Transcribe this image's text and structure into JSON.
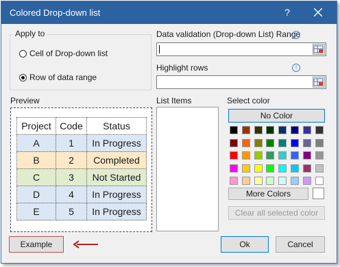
{
  "window": {
    "title": "Colored Drop-down list",
    "help_glyph": "?"
  },
  "apply_to": {
    "label": "Apply to",
    "options": [
      {
        "label": "Cell of Drop-down list",
        "checked": false
      },
      {
        "label": "Row of data range",
        "checked": true
      }
    ]
  },
  "data_validation": {
    "label": "Data validation (Drop-down List) Range",
    "value": ""
  },
  "highlight_rows": {
    "label": "Highlight rows",
    "value": ""
  },
  "preview": {
    "label": "Preview",
    "headers": [
      "Project",
      "Code",
      "Status"
    ],
    "rows": [
      {
        "project": "A",
        "code": "1",
        "status": "In Progress",
        "color": "#dbe7f4"
      },
      {
        "project": "B",
        "code": "2",
        "status": "Completed",
        "color": "#fde9c8"
      },
      {
        "project": "C",
        "code": "3",
        "status": "Not Started",
        "color": "#e1eccf"
      },
      {
        "project": "D",
        "code": "4",
        "status": "In Progress",
        "color": "#dbe7f4"
      },
      {
        "project": "E",
        "code": "5",
        "status": "In Progress",
        "color": "#dbe7f4"
      }
    ]
  },
  "list_items": {
    "label": "List Items",
    "items": []
  },
  "select_color": {
    "label": "Select color",
    "no_color_label": "No Color",
    "more_colors_label": "More Colors",
    "clear_label": "Clear all selected color",
    "palette": [
      [
        "#000000",
        "#993300",
        "#333300",
        "#003300",
        "#003366",
        "#000080",
        "#333399",
        "#333333"
      ],
      [
        "#800000",
        "#ff6600",
        "#808000",
        "#008000",
        "#008080",
        "#0000ff",
        "#666699",
        "#808080"
      ],
      [
        "#ff0000",
        "#ff9900",
        "#99cc00",
        "#339966",
        "#33cccc",
        "#3366ff",
        "#800080",
        "#969696"
      ],
      [
        "#ff00ff",
        "#ffcc00",
        "#ffff00",
        "#00ff00",
        "#00ffff",
        "#00ccff",
        "#993366",
        "#c0c0c0"
      ],
      [
        "#ff99cc",
        "#ffcc99",
        "#ffff99",
        "#ccffcc",
        "#ccffff",
        "#99ccff",
        "#cc99ff",
        "#ffffff"
      ]
    ]
  },
  "buttons": {
    "example": "Example",
    "ok": "Ok",
    "cancel": "Cancel"
  }
}
